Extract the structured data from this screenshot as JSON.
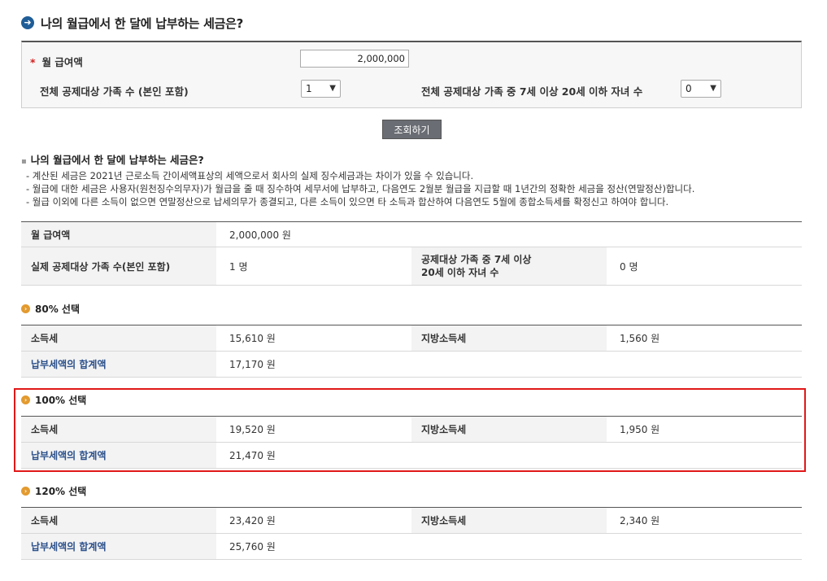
{
  "header": {
    "title": "나의 월급에서 한 달에 납부하는 세금은?",
    "icon": "arrow-right-circle-icon"
  },
  "form": {
    "required_mark": "*",
    "salary_label": "월 급여액",
    "salary_value": "2,000,000",
    "family_label": "전체 공제대상 가족 수 (본인 포함)",
    "family_value": "1",
    "children_label": "전체 공제대상 가족 중 7세 이상 20세 이하 자녀 수",
    "children_value": "0"
  },
  "inquiry_button": "조회하기",
  "result": {
    "subtitle": "나의 월급에서 한 달에 납부하는 세금은?",
    "notes": [
      "- 계산된 세금은  2021년  근로소득 간이세액표상의 세액으로서 회사의 실제 징수세금과는 차이가 있을 수 있습니다.",
      "- 월급에 대한 세금은 사용자(원천징수의무자)가 월급을 줄 때 징수하여 세무서에 납부하고, 다음연도 2월분 월급을 지급할 때 1년간의 정확한 세금을 정산(연말정산)합니다.",
      "- 월급 이외에 다른 소득이 없으면 연말정산으로 납세의무가 종결되고, 다른 소득이 있으면 타 소득과 합산하여 다음연도 5월에 종합소득세를 확정신고 하여야 합니다."
    ]
  },
  "summary": {
    "salary_label": "월 급여액",
    "salary_value": "2,000,000  원",
    "family_label": "실제 공제대상 가족 수(본인 포함)",
    "family_value": "1  명",
    "children_label_1": "공제대상 가족 중 7세 이상",
    "children_label_2": "20세 이하 자녀 수",
    "children_value": "0  명"
  },
  "sections": [
    {
      "title": "80% 선택",
      "income_tax_label": "소득세",
      "income_tax": "15,610  원",
      "local_tax_label": "지방소득세",
      "local_tax": "1,560  원",
      "total_label": "납부세액의 합계액",
      "total": "17,170  원"
    },
    {
      "title": "100% 선택",
      "income_tax_label": "소득세",
      "income_tax": "19,520  원",
      "local_tax_label": "지방소득세",
      "local_tax": "1,950  원",
      "total_label": "납부세액의 합계액",
      "total": "21,470  원"
    },
    {
      "title": "120% 선택",
      "income_tax_label": "소득세",
      "income_tax": "23,420  원",
      "local_tax_label": "지방소득세",
      "local_tax": "2,340  원",
      "total_label": "납부세액의 합계액",
      "total": "25,760  원"
    }
  ],
  "colors": {
    "highlight": "#e01818",
    "section_icon": "#e39a2e",
    "title_icon": "#1f5d97",
    "total_label": "#2a4f8a"
  }
}
